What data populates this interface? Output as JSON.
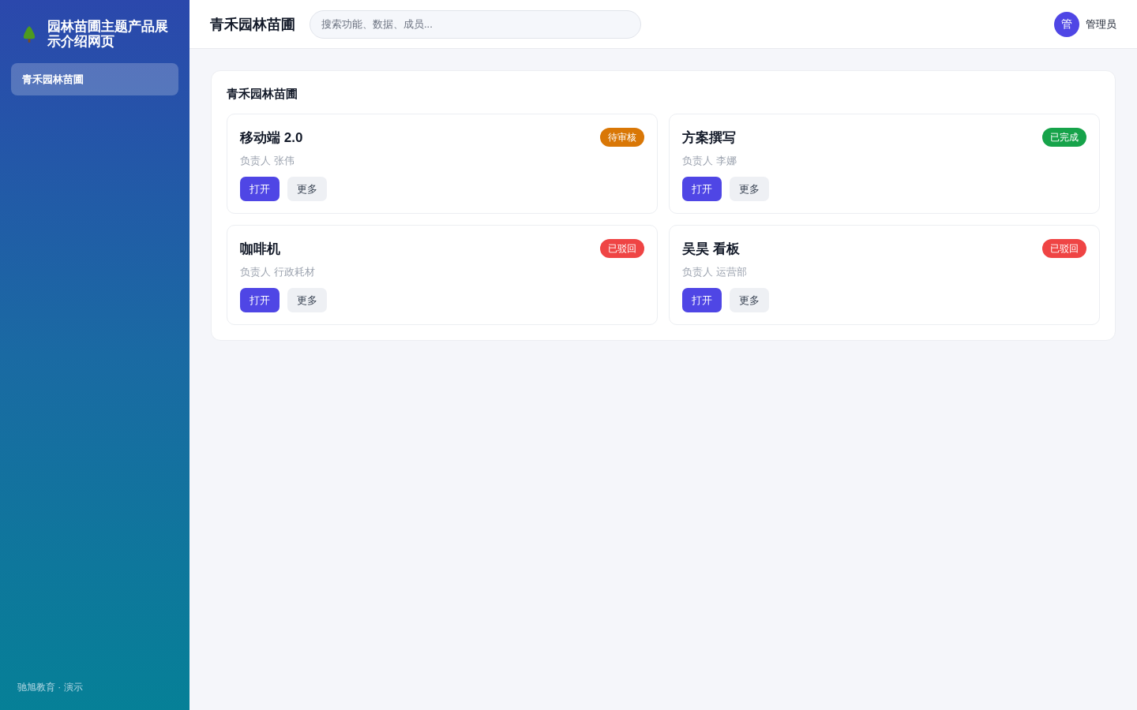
{
  "sidebar": {
    "brand": "园林苗圃主题产品展示介绍网页",
    "items": [
      {
        "label": "青禾园林苗圃",
        "selected": true
      }
    ],
    "footer": "驰旭教育 · 演示"
  },
  "topbar": {
    "title": "青禾园林苗圃",
    "search": {
      "placeholder": "搜索功能、数据、成员..."
    },
    "user": {
      "avatar": "管",
      "name": "管理员"
    }
  },
  "panel": {
    "title": "青禾园林苗圃",
    "cards": [
      {
        "title": "移动端 2.0",
        "status": "待审核",
        "color": "#d97706",
        "owner": "负责人 张伟",
        "buttons": [
          "打开",
          "更多"
        ]
      },
      {
        "title": "方案撰写",
        "status": "已完成",
        "color": "#16a34a",
        "owner": "负责人 李娜",
        "buttons": [
          "打开",
          "更多"
        ]
      },
      {
        "title": "咖啡机",
        "status": "已驳回",
        "color": "#ef4444",
        "owner": "负责人 行政耗材",
        "buttons": [
          "打开",
          "更多"
        ]
      },
      {
        "title": "吴昊 看板",
        "status": "已驳回",
        "color": "#ef4444",
        "owner": "负责人 运营部",
        "buttons": [
          "打开",
          "更多"
        ]
      }
    ]
  }
}
